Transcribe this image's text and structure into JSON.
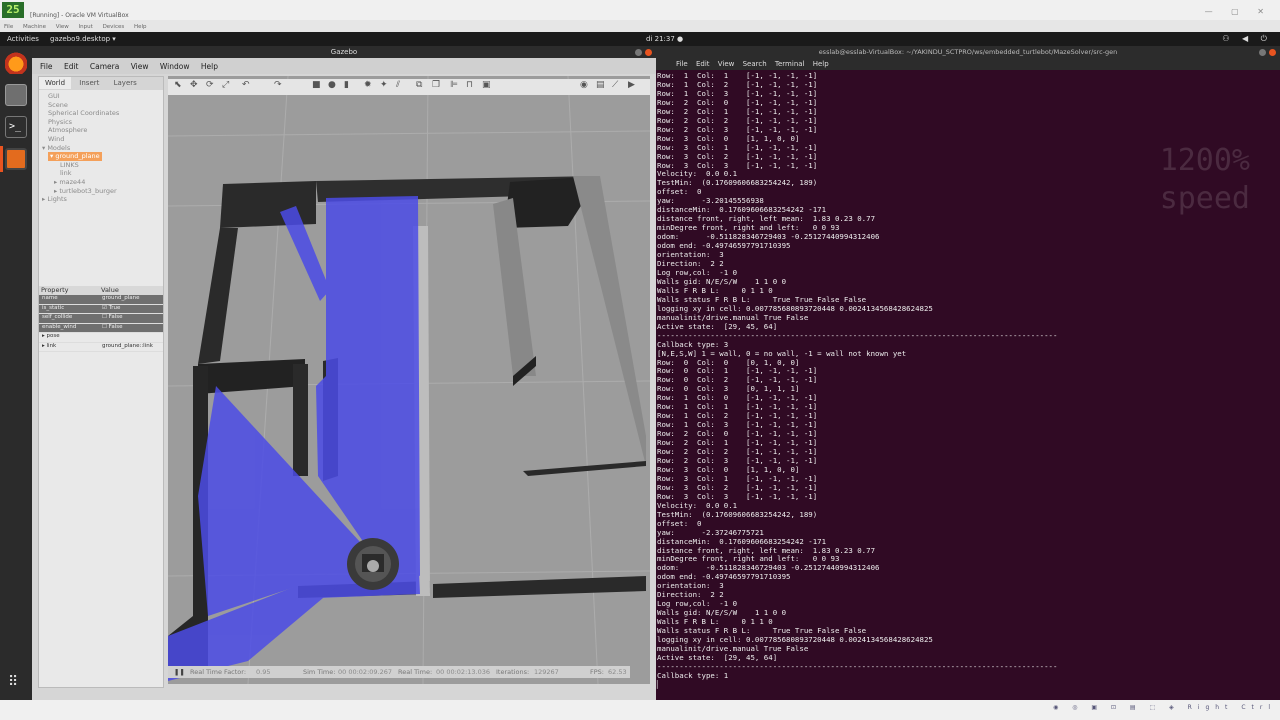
{
  "vbox": {
    "logo": "25",
    "title": "[Running] - Oracle VM VirtualBox",
    "menu": [
      "File",
      "Machine",
      "View",
      "Input",
      "Devices",
      "Help"
    ],
    "status_hint": "Right Ctrl"
  },
  "topbar": {
    "activities": "Activities",
    "app_menu": "gazebo9.desktop ▾",
    "clock": "di 21:37 ●"
  },
  "gazebo": {
    "window_title": "Gazebo",
    "menu": [
      "File",
      "Edit",
      "Camera",
      "View",
      "Window",
      "Help"
    ],
    "tabs": [
      "World",
      "Insert",
      "Layers"
    ],
    "tree": [
      {
        "label": "GUI",
        "indent": 1
      },
      {
        "label": "Scene",
        "indent": 1
      },
      {
        "label": "Spherical Coordinates",
        "indent": 1
      },
      {
        "label": "Physics",
        "indent": 1
      },
      {
        "label": "Atmosphere",
        "indent": 1
      },
      {
        "label": "Wind",
        "indent": 1
      },
      {
        "label": "▾ Models",
        "indent": 0
      },
      {
        "label": "▾ ground_plane",
        "indent": 1,
        "highlight": true
      },
      {
        "label": "LINKS",
        "indent": 3
      },
      {
        "label": "link",
        "indent": 3
      },
      {
        "label": "▸ maze44",
        "indent": 2
      },
      {
        "label": "▸ turtlebot3_burger",
        "indent": 2
      },
      {
        "label": "▸ Lights",
        "indent": 0
      }
    ],
    "props_header": {
      "property": "Property",
      "value": "Value"
    },
    "props": [
      {
        "property": "name",
        "value": "ground_plane",
        "dark": true
      },
      {
        "property": "is_static",
        "value": "☑ True",
        "dark": true
      },
      {
        "property": "self_collide",
        "value": "☐ False",
        "dark": true
      },
      {
        "property": "enable_wind",
        "value": "☐ False",
        "dark": true
      },
      {
        "property": "▸ pose",
        "value": "",
        "dark": false
      },
      {
        "property": "▸ link",
        "value": "ground_plane::link",
        "dark": false
      }
    ],
    "statusbar": {
      "pause": "❚❚",
      "rtf_label": "Real Time Factor:",
      "rtf": "0.95",
      "sim_label": "Sim Time:",
      "sim": "00 00:02:09.267",
      "real_label": "Real Time:",
      "real": "00 00:02:13.036",
      "iter_label": "Iterations:",
      "iter": "129267",
      "fps_label": "FPS:",
      "fps": "62.53"
    }
  },
  "terminal": {
    "window_title": "esslab@esslab-VirtualBox: ~/YAKINDU_SCTPRO/ws/embedded_turtlebot/MazeSolver/src-gen",
    "menu": [
      "File",
      "Edit",
      "View",
      "Search",
      "Terminal",
      "Help"
    ],
    "overlay": [
      "1200%",
      "speed"
    ],
    "lines": [
      "Row:  1  Col:  1    [-1, -1, -1, -1]",
      "Row:  1  Col:  2    [-1, -1, -1, -1]",
      "Row:  1  Col:  3    [-1, -1, -1, -1]",
      "Row:  2  Col:  0    [-1, -1, -1, -1]",
      "Row:  2  Col:  1    [-1, -1, -1, -1]",
      "Row:  2  Col:  2    [-1, -1, -1, -1]",
      "Row:  2  Col:  3    [-1, -1, -1, -1]",
      "Row:  3  Col:  0    [1, 1, 0, 0]",
      "Row:  3  Col:  1    [-1, -1, -1, -1]",
      "Row:  3  Col:  2    [-1, -1, -1, -1]",
      "Row:  3  Col:  3    [-1, -1, -1, -1]",
      "Velocity:  0.0 0.1",
      "TestMin:  (0.17609606683254242, 189)",
      "offset:  0",
      "yaw:      -3.20145556938",
      "distanceMin:  0.17609606683254242 -171",
      "distance front, right, left mean:  1.83 0.23 0.77",
      "minDegree front, right and left:   0 0 93",
      "odom:      -0.511828346729403 -0.25127440994312406",
      "odom end: -0.49746597791710395",
      "orientation:  3",
      "Direction:  2 2",
      "Log row,col:  -1 0",
      "Walls gid: N/E/S/W    1 1 0 0",
      "Walls F R B L:     0 1 1 0",
      "Walls status F R B L:     True True False False",
      "logging xy in cell: 0.007785680893720448 0.0024134568428624825",
      "manualinit/drive.manual True False",
      "Active state:  [29, 45, 64]",
      "------------------------------------------------------------------------------------------",
      "Callback type: 3",
      "[N,E,S,W] 1 = wall, 0 = no wall, -1 = wall not known yet",
      "Row:  0  Col:  0    [0, 1, 0, 0]",
      "Row:  0  Col:  1    [-1, -1, -1, -1]",
      "Row:  0  Col:  2    [-1, -1, -1, -1]",
      "Row:  0  Col:  3    [0, 1, 1, 1]",
      "Row:  1  Col:  0    [-1, -1, -1, -1]",
      "Row:  1  Col:  1    [-1, -1, -1, -1]",
      "Row:  1  Col:  2    [-1, -1, -1, -1]",
      "Row:  1  Col:  3    [-1, -1, -1, -1]",
      "Row:  2  Col:  0    [-1, -1, -1, -1]",
      "Row:  2  Col:  1    [-1, -1, -1, -1]",
      "Row:  2  Col:  2    [-1, -1, -1, -1]",
      "Row:  2  Col:  3    [-1, -1, -1, -1]",
      "Row:  3  Col:  0    [1, 1, 0, 0]",
      "Row:  3  Col:  1    [-1, -1, -1, -1]",
      "Row:  3  Col:  2    [-1, -1, -1, -1]",
      "Row:  3  Col:  3    [-1, -1, -1, -1]",
      "Velocity:  0.0 0.1",
      "TestMin:  (0.17609606683254242, 189)",
      "offset:  0",
      "yaw:      -2.37246775721",
      "distanceMin:  0.17609606683254242 -171",
      "distance front, right, left mean:  1.83 0.23 0.77",
      "minDegree front, right and left:   0 0 93",
      "odom:      -0.511828346729403 -0.25127440994312406",
      "odom end: -0.49746597791710395",
      "orientation:  3",
      "Direction:  2 2",
      "Log row,col:  -1 0",
      "Walls gid: N/E/S/W    1 1 0 0",
      "Walls F R B L:     0 1 1 0",
      "Walls status F R B L:     True True False False",
      "logging xy in cell: 0.007785680893720448 0.0024134568428624825",
      "manualinit/drive.manual True False",
      "Active state:  [29, 45, 64]",
      "------------------------------------------------------------------------------------------",
      "Callback type: 1",
      "▏"
    ]
  }
}
